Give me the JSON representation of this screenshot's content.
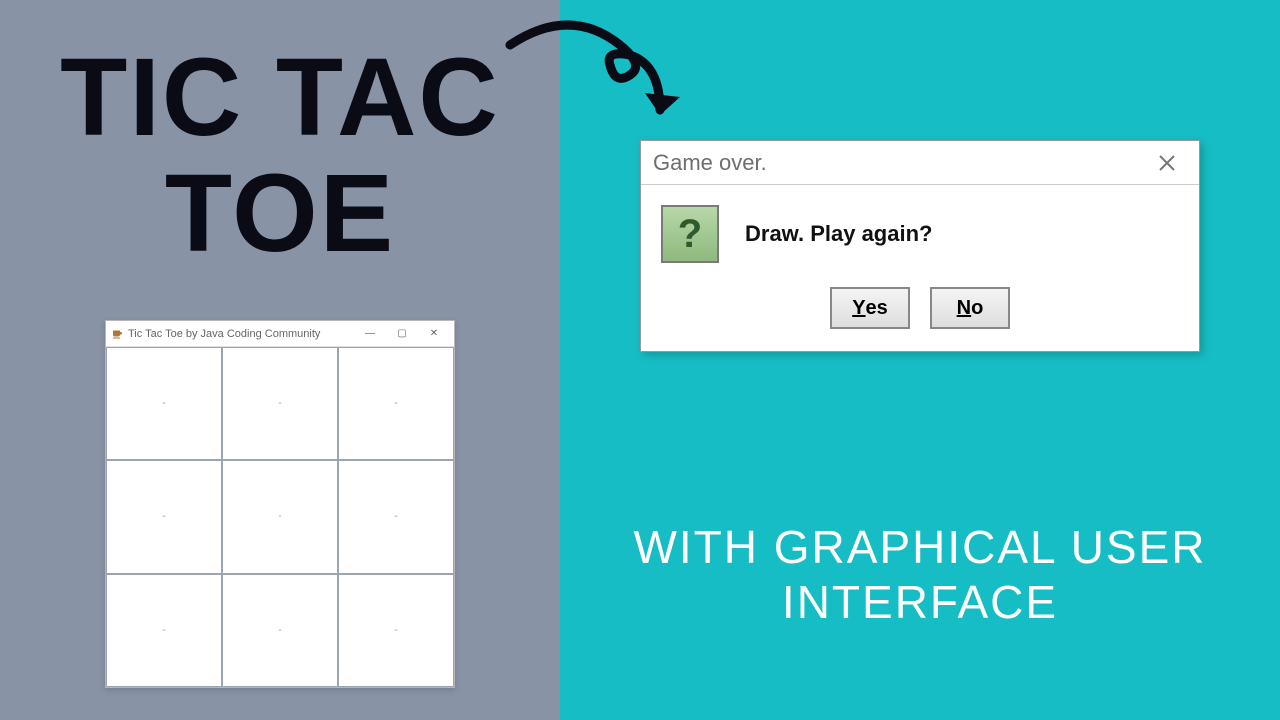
{
  "left": {
    "title_line1": "TIC TAC",
    "title_line2": "TOE",
    "game_window": {
      "title": "Tic Tac Toe by Java Coding Community",
      "min": "—",
      "max": "▢",
      "close": "✕",
      "cells": [
        "-",
        "-",
        "-",
        "-",
        "-",
        "-",
        "-",
        "-",
        "-"
      ]
    }
  },
  "right": {
    "dialog": {
      "title": "Game over.",
      "close": "✕",
      "icon": "?",
      "message": "Draw. Play again?",
      "yes_u": "Y",
      "yes_rest": "es",
      "no_u": "N",
      "no_rest": "o"
    },
    "subtitle_line1": "WITH GRAPHICAL USER",
    "subtitle_line2": "INTERFACE"
  }
}
